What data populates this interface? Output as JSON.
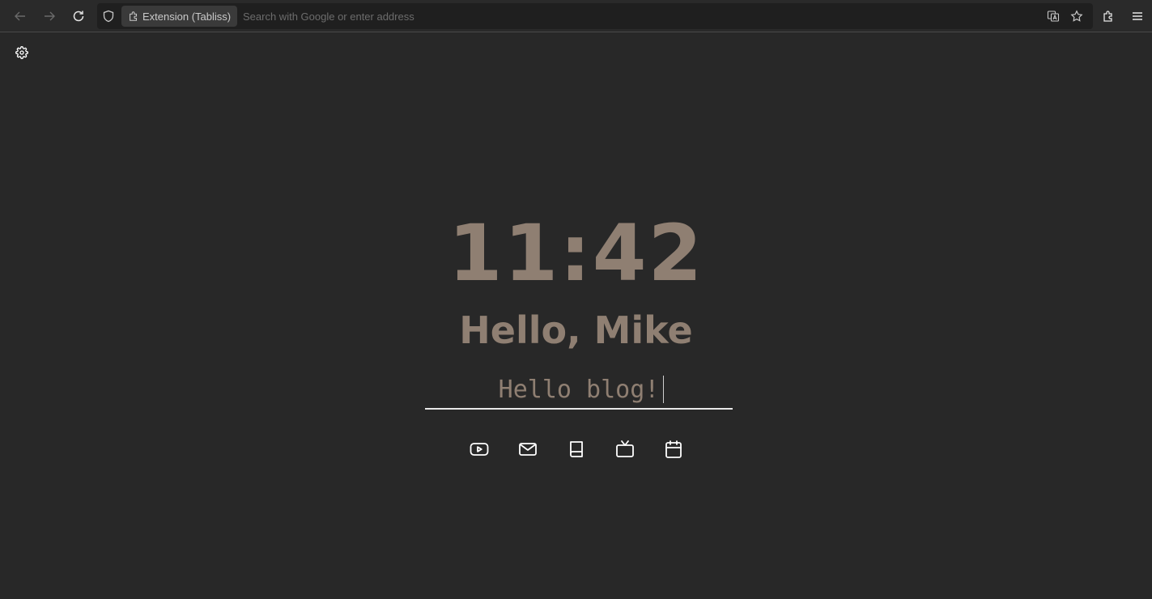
{
  "browser": {
    "identity_label": "Extension (Tabliss)",
    "url_placeholder": "Search with Google or enter address",
    "icons": [
      "back-icon",
      "forward-icon",
      "reload-icon",
      "shield-icon",
      "extension-icon",
      "translate-icon",
      "bookmark-star-icon",
      "extensions-icon",
      "menu-icon"
    ]
  },
  "newtab": {
    "clock": "11:42",
    "greeting": "Hello, Mike",
    "todo_value": "Hello blog!",
    "links": [
      {
        "name": "youtube",
        "icon": "youtube-icon"
      },
      {
        "name": "mail",
        "icon": "mail-icon"
      },
      {
        "name": "book",
        "icon": "book-icon"
      },
      {
        "name": "tv",
        "icon": "tv-icon"
      },
      {
        "name": "calendar",
        "icon": "calendar-icon"
      }
    ]
  },
  "colors": {
    "background": "#282828",
    "text_accent": "#8f7f72",
    "icon": "#ffffff"
  }
}
